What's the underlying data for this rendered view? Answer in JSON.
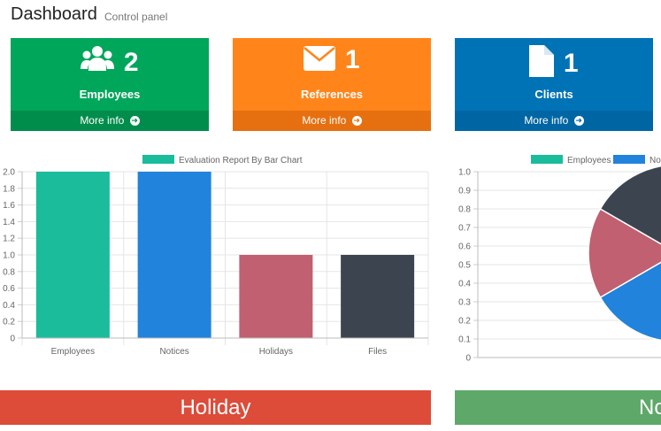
{
  "header": {
    "title": "Dashboard",
    "subtitle": "Control panel"
  },
  "boxes": [
    {
      "value": "2",
      "label": "Employees",
      "more": "More info",
      "icon": "users-icon",
      "color": "#00a65a"
    },
    {
      "value": "1",
      "label": "References",
      "more": "More info",
      "icon": "envelope-icon",
      "color": "#ff851b"
    },
    {
      "value": "1",
      "label": "Clients",
      "more": "More info",
      "icon": "file-icon",
      "color": "#0073b7"
    }
  ],
  "chart_data": [
    {
      "type": "bar",
      "title": "",
      "legend": "Evaluation Report By Bar Chart",
      "legend_position": "top",
      "categories": [
        "Employees",
        "Notices",
        "Holidays",
        "Files"
      ],
      "values": [
        2,
        2,
        1,
        1
      ],
      "colors": [
        "#1abc9c",
        "#2183db",
        "#c06070",
        "#3c454f"
      ],
      "ylim": [
        0,
        2.0
      ],
      "yticks": [
        "0",
        "0.2",
        "0.4",
        "0.6",
        "0.8",
        "1.0",
        "1.2",
        "1.4",
        "1.6",
        "1.8",
        "2.0"
      ],
      "grid": true
    },
    {
      "type": "pie",
      "legend": [
        "Employees",
        "Noti"
      ],
      "legend_position": "top",
      "colors": [
        "#1abc9c",
        "#2183db",
        "#c06070",
        "#3c454f"
      ],
      "yticks": [
        "0",
        "0.1",
        "0.2",
        "0.3",
        "0.4",
        "0.5",
        "0.6",
        "0.7",
        "0.8",
        "0.9",
        "1.0"
      ],
      "values": [
        2,
        2,
        1,
        1
      ]
    }
  ],
  "banners": {
    "left": "Holiday",
    "right": "No"
  }
}
